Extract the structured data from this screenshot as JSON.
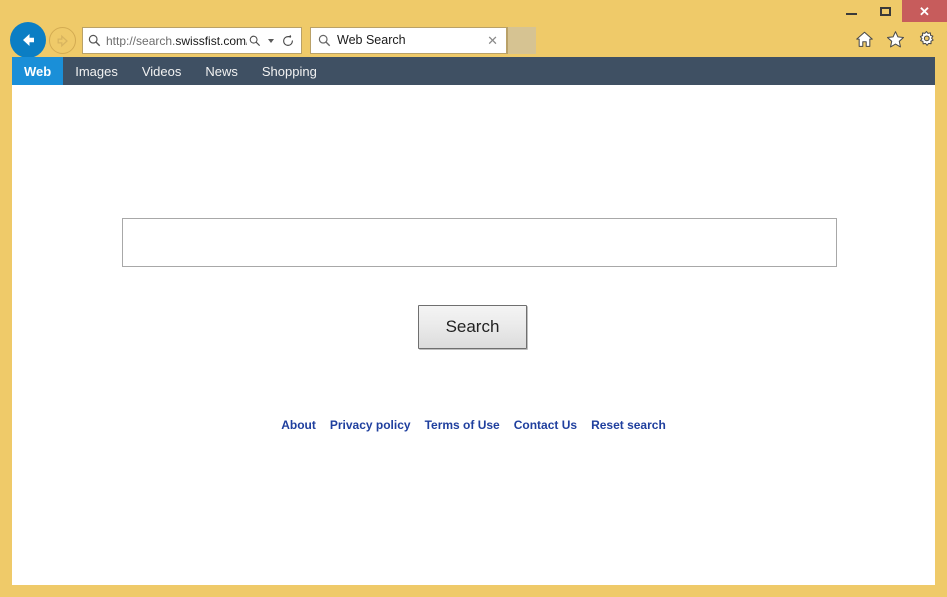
{
  "window": {
    "chrome_color": "#efca69",
    "controls": {
      "minimize_label": "−",
      "maximize_label": "□",
      "close_label": "✕",
      "close_color": "#c75c5c"
    }
  },
  "browser": {
    "back_icon": "back-arrow-icon",
    "forward_icon": "forward-arrow-icon",
    "address": {
      "favicon": "search-magnifier-icon",
      "url_scheme": "http://search.",
      "url_host": "swissfist.com",
      "url_path": "/",
      "url_full": "http://search.swissfist.com/",
      "search_icon": "magnifier-icon",
      "dropdown_icon": "chevron-down-icon",
      "refresh_icon": "refresh-icon"
    },
    "tab": {
      "favicon": "magnifier-icon",
      "title": "Web Search",
      "close_label": "✕"
    },
    "new_tab_label": "",
    "toolbar_icons": [
      {
        "name": "home-icon"
      },
      {
        "name": "favorites-star-icon"
      },
      {
        "name": "settings-gear-icon"
      }
    ]
  },
  "site": {
    "nav": {
      "background_color": "#3f5063",
      "active_color": "#1a8fd8",
      "items": [
        {
          "label": "Web",
          "active": true
        },
        {
          "label": "Images",
          "active": false
        },
        {
          "label": "Videos",
          "active": false
        },
        {
          "label": "News",
          "active": false
        },
        {
          "label": "Shopping",
          "active": false
        }
      ]
    },
    "search": {
      "value": "",
      "placeholder": "",
      "button_label": "Search"
    },
    "footer": {
      "link_color": "#1f3f9e",
      "links": [
        {
          "label": "About"
        },
        {
          "label": "Privacy policy"
        },
        {
          "label": "Terms of Use"
        },
        {
          "label": "Contact Us"
        },
        {
          "label": "Reset search"
        }
      ]
    }
  }
}
